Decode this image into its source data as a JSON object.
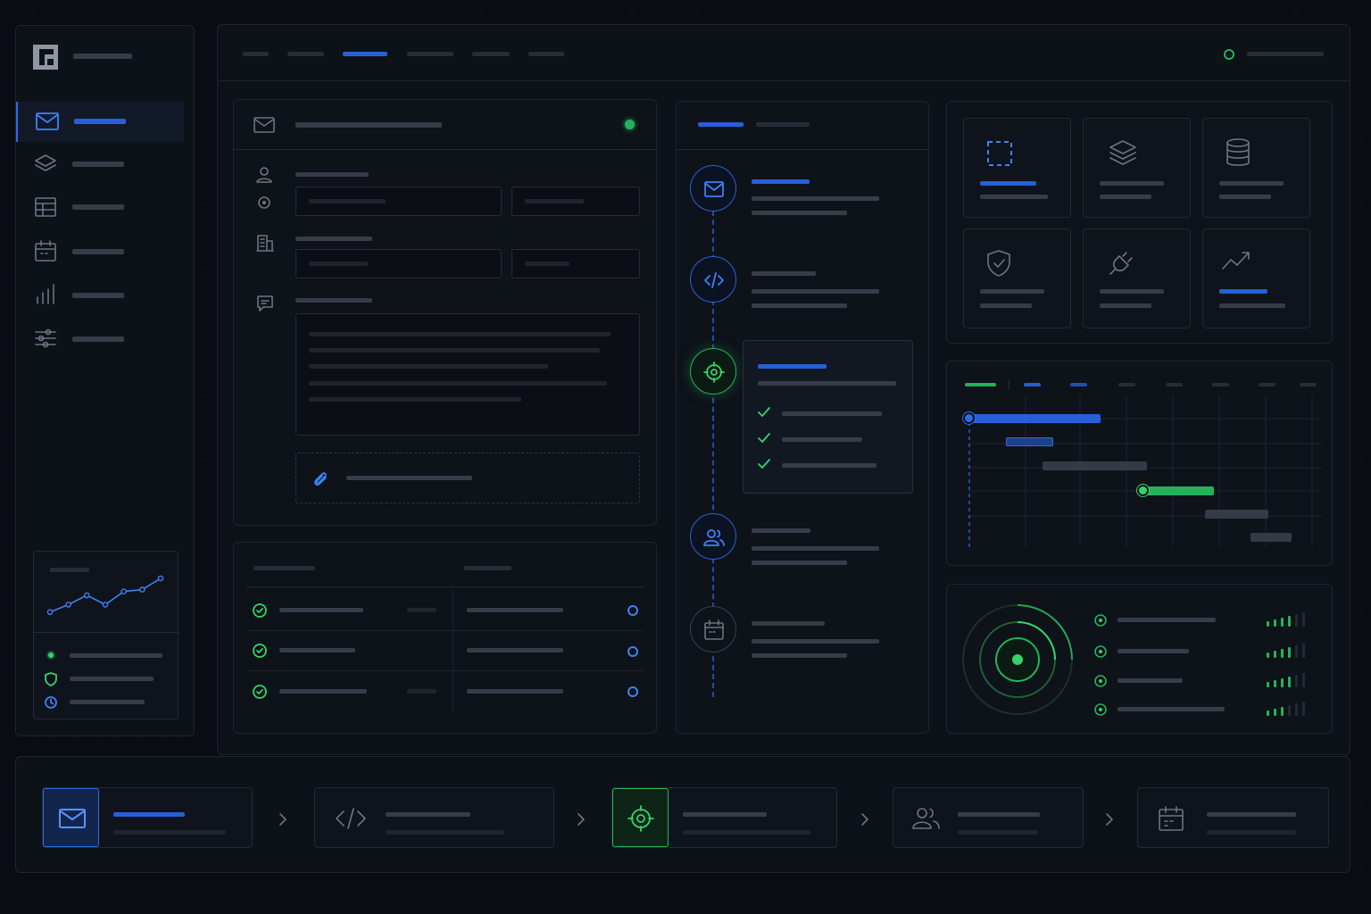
{
  "app": {
    "logo": "app-logo-icon"
  },
  "sidebar": {
    "items": [
      {
        "icon": "mail-icon",
        "active": true
      },
      {
        "icon": "layers-icon",
        "active": false
      },
      {
        "icon": "table-icon",
        "active": false
      },
      {
        "icon": "calendar-icon",
        "active": false
      },
      {
        "icon": "bar-chart-icon",
        "active": false
      },
      {
        "icon": "sliders-icon",
        "active": false
      }
    ],
    "mini_chart": {
      "points": [
        0.1,
        0.3,
        0.55,
        0.3,
        0.65,
        0.7,
        1.0
      ]
    },
    "status_icons": [
      "status-dot-icon",
      "shield-icon",
      "clock-icon"
    ]
  },
  "topbar": {
    "active_tab_index": 2,
    "status_color": "#22b35a"
  },
  "form": {
    "icons": [
      "mail-icon",
      "user-icon",
      "location-icon",
      "building-icon",
      "message-icon",
      "paperclip-icon"
    ],
    "status_color": "#22b35a"
  },
  "timeline": {
    "steps": [
      "mail-icon",
      "code-icon",
      "target-icon",
      "users-icon",
      "calendar-icon"
    ],
    "active_index": 2
  },
  "tiles": [
    "selection-icon",
    "layers-icon",
    "database-icon",
    "shield-icon",
    "plug-icon",
    "trend-icon"
  ],
  "gantt": {
    "bars": [
      0.0,
      0.2,
      0.4,
      0.6,
      0.8
    ]
  },
  "monitor": {
    "signal_levels": [
      4,
      4,
      4,
      3
    ]
  },
  "pipeline": {
    "steps": [
      "mail-icon",
      "code-icon",
      "target-icon",
      "users-icon",
      "calendar-icon"
    ],
    "active_index": 0,
    "current_index": 2
  },
  "colors": {
    "accent": "#2660d8",
    "success": "#22b35a",
    "background": "#090c12"
  }
}
